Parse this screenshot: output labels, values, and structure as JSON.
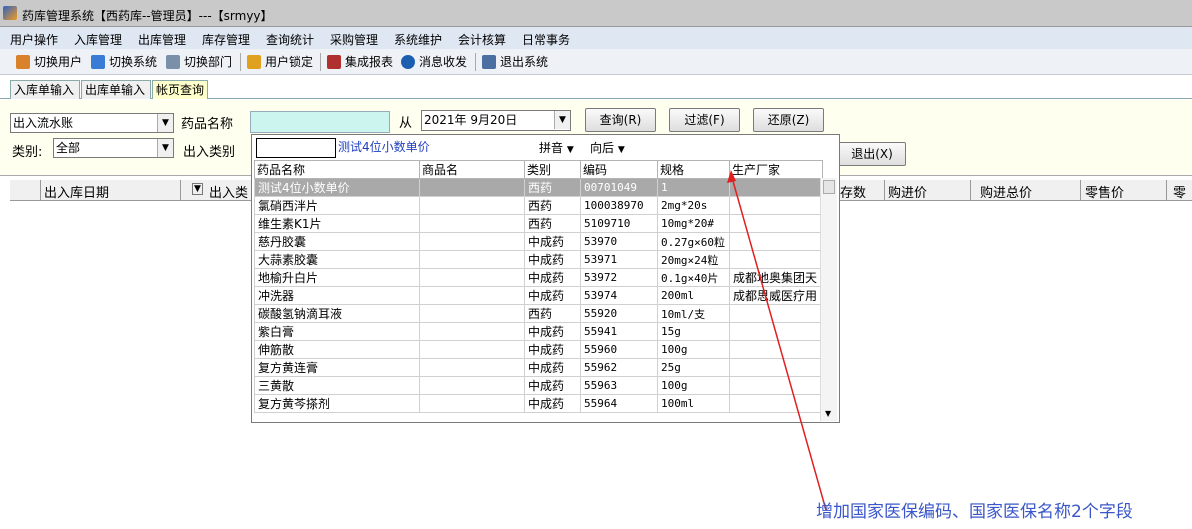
{
  "window": {
    "title": "药库管理系统【西药库--管理员】---【srmyy】"
  },
  "menu": [
    "用户操作",
    "入库管理",
    "出库管理",
    "库存管理",
    "查询统计",
    "采购管理",
    "系统维护",
    "会计核算",
    "日常事务"
  ],
  "toolbar": [
    {
      "label": "切换用户",
      "icon": "user-switch-icon",
      "color": "#d9822b"
    },
    {
      "label": "切换系统",
      "icon": "system-switch-icon",
      "color": "#3a7bd5"
    },
    {
      "label": "切换部门",
      "icon": "department-icon",
      "color": "#7a8fa8"
    },
    {
      "label": "用户锁定",
      "icon": "lock-user-icon",
      "color": "#e0a020"
    },
    {
      "label": "集成报表",
      "icon": "report-icon",
      "color": "#b03030"
    },
    {
      "label": "消息收发",
      "icon": "info-icon",
      "color": "#1c5fb0"
    },
    {
      "label": "退出系统",
      "icon": "exit-icon",
      "color": "#4a6fa0"
    }
  ],
  "tabs": [
    "入库单输入",
    "出库单输入",
    "帐页查询"
  ],
  "filter": {
    "flow_type": "出入流水账",
    "drug_name_label": "药品名称",
    "from_label": "从",
    "date": "2021年  9月20日",
    "query_btn": "查询(R)",
    "filter_btn": "过滤(F)",
    "restore_btn": "还原(Z)",
    "category_label": "类别:",
    "category_value": "全部",
    "inout_type_label": "出入类别",
    "exit_btn": "退出(X)"
  },
  "grid_headers": [
    "出入库日期",
    "出入类",
    "存数",
    "购进价",
    "购进总价",
    "零售价",
    "零"
  ],
  "popup": {
    "search_value": "",
    "hint": "测试4位小数单价",
    "pinyin": "拼音",
    "direction": "向后",
    "columns": [
      "药品名称",
      "商品名",
      "类别",
      "编码",
      "规格",
      "生产厂家"
    ],
    "rows": [
      [
        "测试4位小数单价",
        "",
        "西药",
        "00701049",
        "1",
        ""
      ],
      [
        "氯硝西泮片",
        "",
        "西药",
        "100038970",
        "2mg*20s",
        ""
      ],
      [
        "维生素K1片",
        "",
        "西药",
        "5109710",
        "10mg*20#",
        ""
      ],
      [
        "慈丹胶囊",
        "",
        "中成药",
        "53970",
        "0.27g×60粒",
        ""
      ],
      [
        "大蒜素胶囊",
        "",
        "中成药",
        "53971",
        "20mg×24粒",
        ""
      ],
      [
        "地榆升白片",
        "",
        "中成药",
        "53972",
        "0.1g×40片",
        "成都地奥集团天"
      ],
      [
        "冲洗器",
        "",
        "中成药",
        "53974",
        "200ml",
        "成都思威医疗用"
      ],
      [
        "碳酸氢钠滴耳液",
        "",
        "西药",
        "55920",
        "10ml/支",
        ""
      ],
      [
        "紫白膏",
        "",
        "中成药",
        "55941",
        "15g",
        ""
      ],
      [
        "伸筋散",
        "",
        "中成药",
        "55960",
        "100g",
        ""
      ],
      [
        "复方黄连膏",
        "",
        "中成药",
        "55962",
        "25g",
        ""
      ],
      [
        "三黄散",
        "",
        "中成药",
        "55963",
        "100g",
        ""
      ],
      [
        "复方黄芩搽剂",
        "",
        "中成药",
        "55964",
        "100ml",
        ""
      ]
    ]
  },
  "annotation": "增加国家医保编码、国家医保名称2个字段"
}
